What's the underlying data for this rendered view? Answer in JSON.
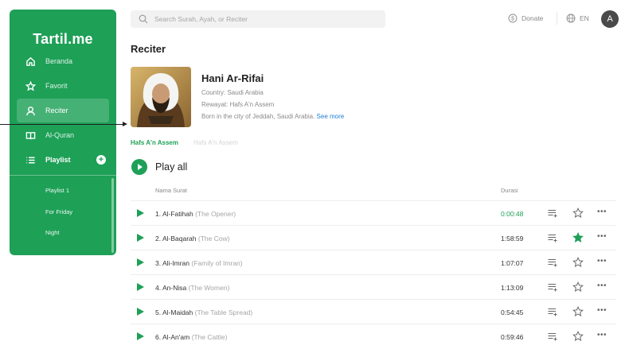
{
  "app": {
    "logo": "Tartil.me"
  },
  "search": {
    "placeholder": "Search Surah, Ayah, or Reciter"
  },
  "topbar": {
    "donate_label": "Donate",
    "lang_label": "EN",
    "avatar_letter": "A"
  },
  "sidebar": {
    "items": [
      {
        "label": "Beranda",
        "icon": "home-icon"
      },
      {
        "label": "Favorit",
        "icon": "star-icon"
      },
      {
        "label": "Reciter",
        "icon": "user-icon"
      },
      {
        "label": "Al-Quran",
        "icon": "book-icon"
      },
      {
        "label": "Playlist",
        "icon": "list-icon"
      }
    ],
    "playlists": [
      "Playlist 1",
      "For Friday",
      "Night"
    ]
  },
  "page": {
    "title": "Reciter"
  },
  "reciter": {
    "name": "Hani Ar-Rifai",
    "country": "Country: Saudi Arabia",
    "rewayat": "Rewayat: Hafs A'n Assem",
    "bio": "Born in the city of Jeddah, Saudi Arabia.",
    "see_more": "See more"
  },
  "tabs": [
    "Hafs A'n Assem",
    "Hafs A'n Assem"
  ],
  "play_all": "Play all",
  "table": {
    "headers": {
      "name": "Nama Surat",
      "duration": "Durasi"
    },
    "rows": [
      {
        "title": "1. Al-Fatihah",
        "translation": "(The Opener)",
        "duration": "0:00:48",
        "favorite": false
      },
      {
        "title": "2. Al-Baqarah",
        "translation": "(The Cow)",
        "duration": "1:58:59",
        "favorite": true
      },
      {
        "title": "3. Ali-Imran",
        "translation": "(Family  of Imran)",
        "duration": "1:07:07",
        "favorite": false
      },
      {
        "title": "4. An-Nisa",
        "translation": "(The Women)",
        "duration": "1:13:09",
        "favorite": false
      },
      {
        "title": "5. Al-Maidah",
        "translation": "(The Table Spread)",
        "duration": "0:54:45",
        "favorite": false
      },
      {
        "title": "6. Al-An'am",
        "translation": "(The Cattle)",
        "duration": "0:59:46",
        "favorite": false
      }
    ]
  },
  "colors": {
    "brand": "#1ea057",
    "link": "#1f7fd0"
  }
}
